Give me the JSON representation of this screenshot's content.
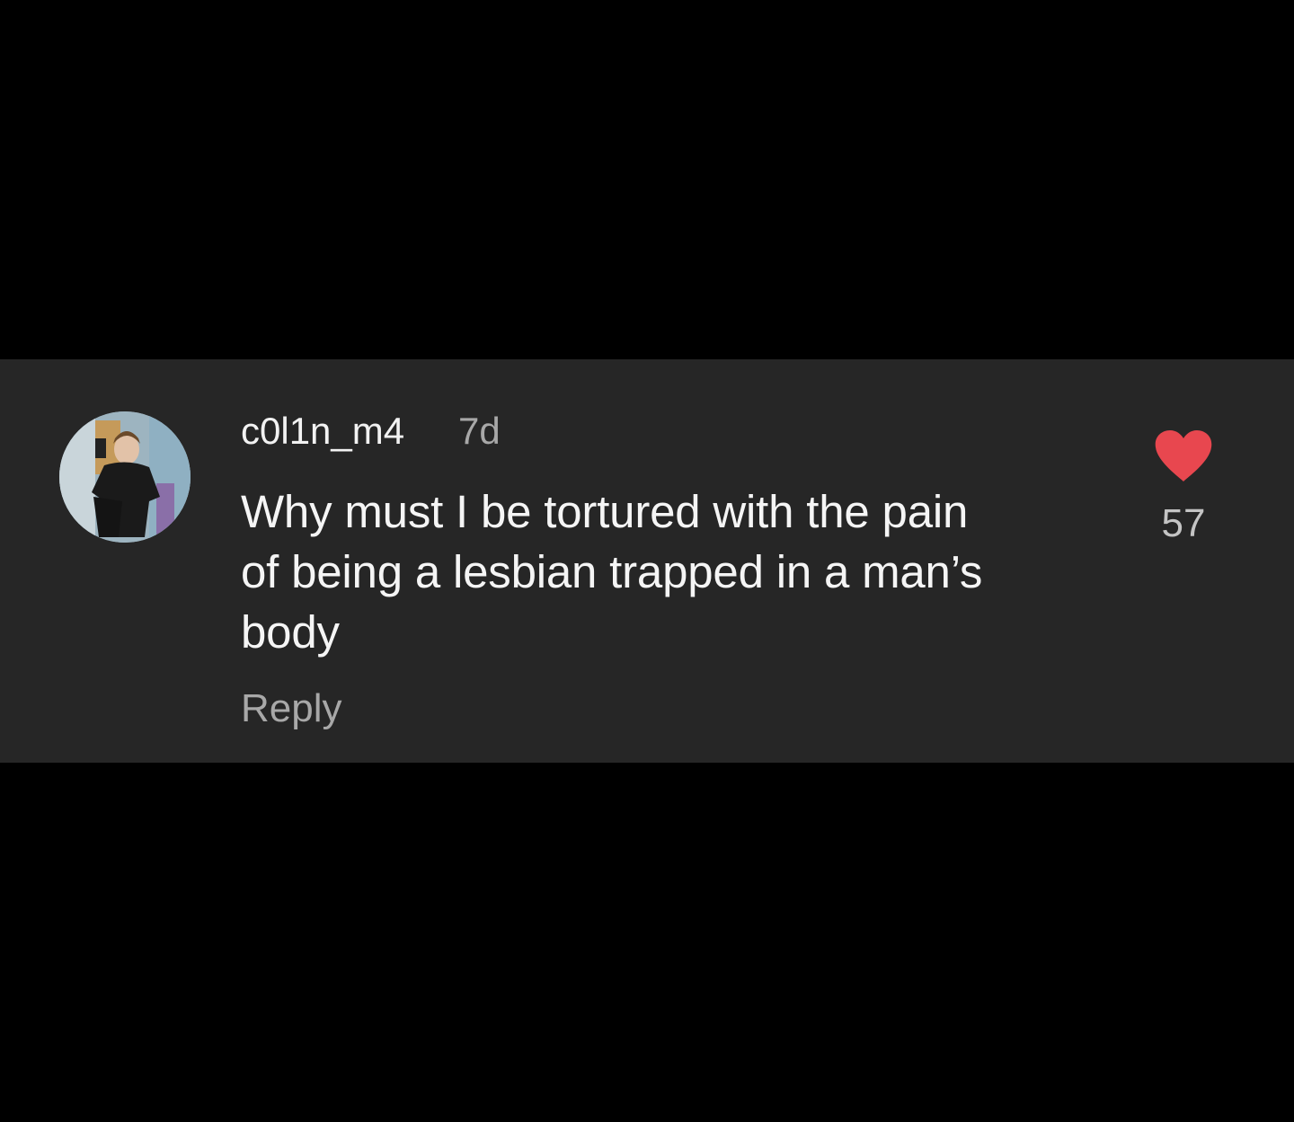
{
  "comment": {
    "username": "c0l1n_m4",
    "timestamp": "7d",
    "text_lines": [
      "Why must I be tortured with the pain",
      "of being a lesbian trapped in a man’s",
      "body"
    ],
    "reply_label": "Reply",
    "like_count": "57",
    "like_icon": "heart-icon",
    "avatar_icon": "avatar"
  },
  "colors": {
    "background": "#000000",
    "card": "#262626",
    "heart": "#e8474f",
    "primary_text": "#f5f5f5",
    "secondary_text": "#a8a8a8"
  }
}
